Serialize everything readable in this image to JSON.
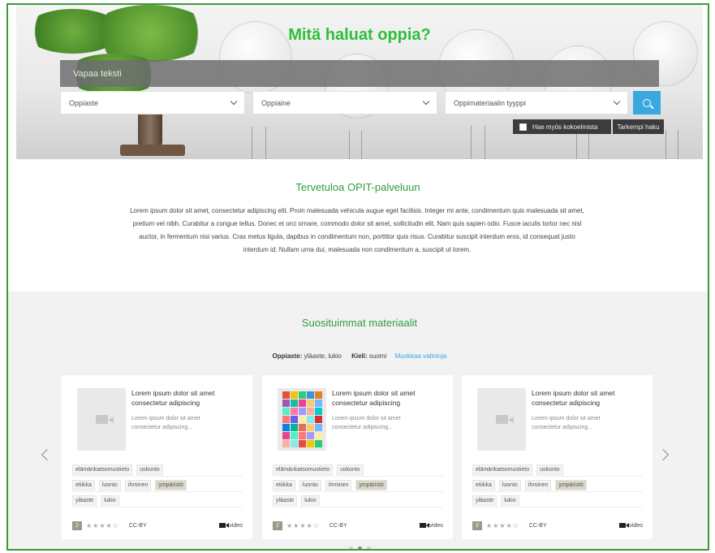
{
  "hero": {
    "title": "Mitä haluat oppia?",
    "search_placeholder": "Vapaa teksti",
    "selects": [
      "Oppiaste",
      "Oppiaine",
      "Oppimateriaalin tyyppi"
    ],
    "include_collections": "Hae myös kokoelmista",
    "advanced_search": "Tarkempi haku"
  },
  "welcome": {
    "title": "Tervetuloa OPIT-palveluun",
    "text": "Lorem ipsum dolor sit amet, consectetur adipiscing elit. Proin malesuada vehicula augue eget facilisis. Integer mi ante, condimentum quis malesuada sit amet, pretium vel nibh. Curabitur a congue tellus. Donec et orci ornare, commodo dolor sit amet, sollicitudin elit. Nam quis sapien odio. Fusce iaculis tortor nec nisl auctor, in fermentum nisi varius. Cras metus ligula, dapibus in condimentum non, porttitor quis risus. Curabitur suscipit interdum eros, id consequat justo interdum id. Nullam urna dui, malesuada non condimentum a, suscipit ut lorem."
  },
  "popular": {
    "title": "Suosituimmat materiaalit",
    "filter_level_label": "Oppiaste:",
    "filter_level_value": "yläaste, lukio",
    "filter_lang_label": "Kieli:",
    "filter_lang_value": "suomi",
    "edit_link": "Muokkaa valintoja",
    "cards": [
      {
        "title": "Lorem ipsum dolor sit amet consectetur adipiscing",
        "desc": "Lorem ipsum dolor sit amet consectetur adipiscing...",
        "thumb": "video-placeholder",
        "tags_row1": [
          "elämänkatsomustieto",
          "uskonto"
        ],
        "tags_row2": [
          "etiikka",
          "luonto",
          "ihminen",
          "ympäristö"
        ],
        "tags_row3": [
          "yläaste",
          "lukio"
        ],
        "badge": "2",
        "stars": "★★★★☆",
        "license": "CC-BY",
        "type": "video"
      },
      {
        "title": "Lorem ipsum dolor sit amet consectetur adipiscing",
        "desc": "Lorem ipsum dolor sit amet consectetur adipiscing...",
        "thumb": "mosaic",
        "tags_row1": [
          "elämänkatsomustieto",
          "uskonto"
        ],
        "tags_row2": [
          "etiikka",
          "luonto",
          "ihminen",
          "ympäristö"
        ],
        "tags_row3": [
          "yläaste",
          "lukio"
        ],
        "badge": "2",
        "stars": "★★★★☆",
        "license": "CC-BY",
        "type": "video"
      },
      {
        "title": "Lorem ipsum dolor sit amet consectetur adipiscing",
        "desc": "Lorem ipsum dolor sit amet consectetur adipiscing...",
        "thumb": "video-placeholder",
        "tags_row1": [
          "elämänkatsomustieto",
          "uskonto"
        ],
        "tags_row2": [
          "etiikka",
          "luonto",
          "ihminen",
          "ympäristö"
        ],
        "tags_row3": [
          "yläaste",
          "lukio"
        ],
        "badge": "2",
        "stars": "★★★★☆",
        "license": "CC-BY",
        "type": "video"
      }
    ],
    "highlighted_tag": "ympäristö"
  },
  "colors": {
    "green": "#2fbf3a",
    "blue": "#3aa8de",
    "frame": "#3a9a3a"
  }
}
